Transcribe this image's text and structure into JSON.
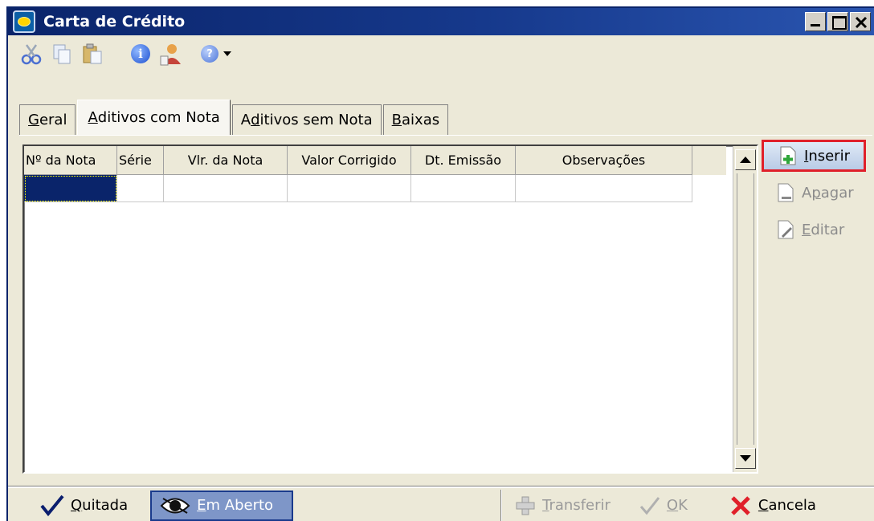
{
  "window": {
    "title": "Carta de Crédito"
  },
  "toolbar": {
    "icons": [
      "cut-icon",
      "copy-icon",
      "paste-icon",
      "info-icon",
      "user-icon",
      "help-icon"
    ],
    "info_glyph": "i",
    "help_glyph": "?"
  },
  "tabs": [
    {
      "label_pre": "",
      "accel": "G",
      "label_post": "eral",
      "active": false
    },
    {
      "label_pre": "",
      "accel": "A",
      "label_post": "ditivos com Nota",
      "active": true
    },
    {
      "label_pre": "A",
      "accel": "d",
      "label_post": "itivos sem Nota",
      "active": false
    },
    {
      "label_pre": "",
      "accel": "B",
      "label_post": "aixas",
      "active": false
    }
  ],
  "grid": {
    "columns": [
      "Nº da Nota",
      "Série",
      "Vlr. da Nota",
      "Valor Corrigido",
      "Dt. Emissão",
      "Observações"
    ],
    "rows": [
      [
        "",
        "",
        "",
        "",
        "",
        ""
      ]
    ]
  },
  "actions": {
    "inserir": {
      "accel": "I",
      "rest": "nserir"
    },
    "apagar": {
      "pre": "A",
      "accel": "p",
      "rest": "agar"
    },
    "editar": {
      "accel": "E",
      "rest": "ditar"
    }
  },
  "status": {
    "quitada": {
      "accel": "Q",
      "rest": "uitada"
    },
    "em_aberto": {
      "accel": "E",
      "rest": "m Aberto"
    },
    "transferir": {
      "accel": "T",
      "rest": "ransferir"
    },
    "ok": {
      "accel": "O",
      "rest": "K"
    },
    "cancela": {
      "accel": "C",
      "rest": "ancela"
    }
  },
  "colors": {
    "title_bar": "#0a246a",
    "highlight": "#e0202a",
    "selection": "#0a246a"
  }
}
